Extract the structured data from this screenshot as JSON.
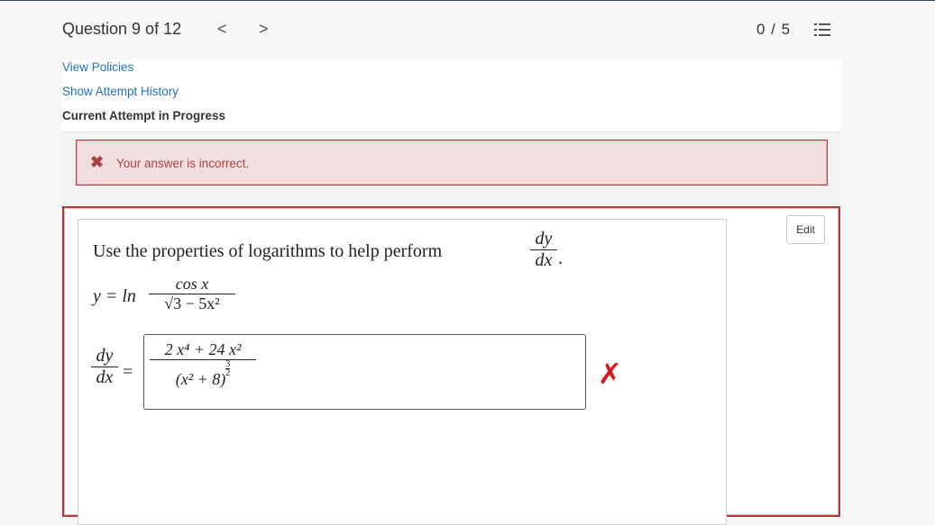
{
  "header": {
    "question_label": "Question 9 of 12",
    "prev_label": "<",
    "next_label": ">",
    "score": "0 / 5"
  },
  "links": {
    "view_policies": "View Policies",
    "show_attempt_history": "Show Attempt History",
    "current_attempt": "Current Attempt in Progress"
  },
  "alert": {
    "icon": "✖",
    "text": "Your answer is incorrect."
  },
  "question": {
    "edit_label": "Edit",
    "prompt_text": "Use the properties of logarithms to help perform",
    "prompt_dy": "dy",
    "prompt_dx": "dx",
    "prompt_end": ".",
    "y_eq": "y = ln",
    "ln_num": "cos x",
    "ln_den": "√3 − 5x²",
    "deriv_num": "dy",
    "deriv_den": "dx",
    "equals": "=",
    "answer_num": "2 x⁴ + 24 x²",
    "answer_den": "(x² + 8)",
    "answer_exp_num": "3",
    "answer_exp_den": "2",
    "result_mark": "✗"
  },
  "colors": {
    "error_red": "#b33b3b",
    "link_blue": "#1f72b8",
    "alert_bg": "#f2dede",
    "wrong_mark": "#d9161c"
  }
}
